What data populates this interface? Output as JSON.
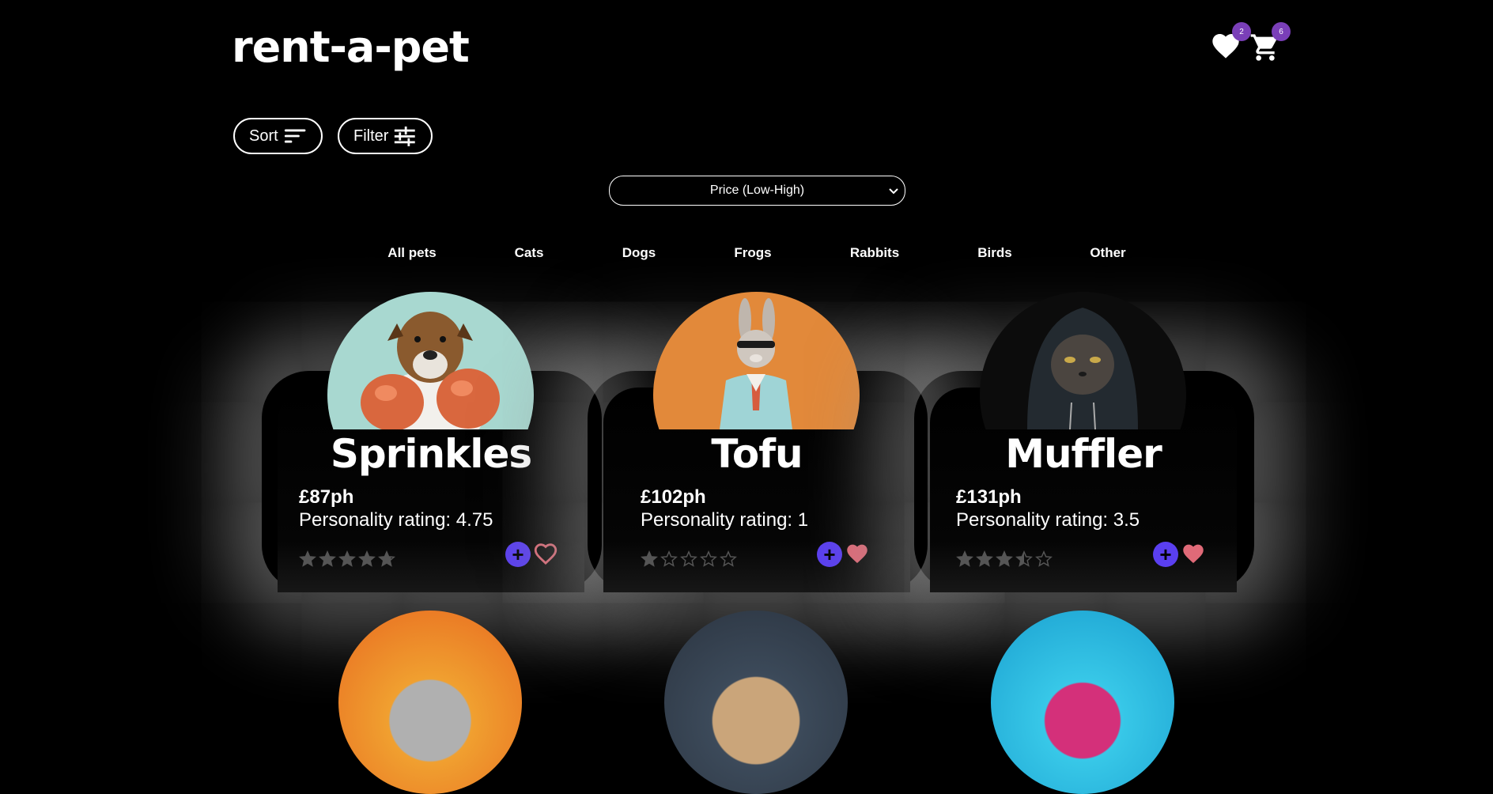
{
  "brand": {
    "logo_text": "rent-a-pet"
  },
  "header": {
    "favorites_count": "2",
    "cart_count": "6",
    "badge_color": "#7a3fb8"
  },
  "toolbar": {
    "sort_label": "Sort",
    "filter_label": "Filter",
    "sort_select": {
      "selected": "Price (Low-High)"
    }
  },
  "categories": [
    "All pets",
    "Cats",
    "Dogs",
    "Frogs",
    "Rabbits",
    "Birds",
    "Other"
  ],
  "pets": [
    {
      "name": "Sprinkles",
      "price": "£87ph",
      "rating_text": "Personality rating: 4.75",
      "stars": 4.75,
      "favorited": false,
      "bg": "#a8d8d0"
    },
    {
      "name": "Tofu",
      "price": "£102ph",
      "rating_text": "Personality rating: 1",
      "stars": 1,
      "favorited": true,
      "bg": "#e2893a"
    },
    {
      "name": "Muffler",
      "price": "£131ph",
      "rating_text": "Personality rating: 3.5",
      "stars": 3.5,
      "favorited": true,
      "bg": "#0c0c0c"
    }
  ],
  "colors": {
    "add_button": "#5a3ff0",
    "heart": "#e06a78",
    "star": "#555555"
  }
}
